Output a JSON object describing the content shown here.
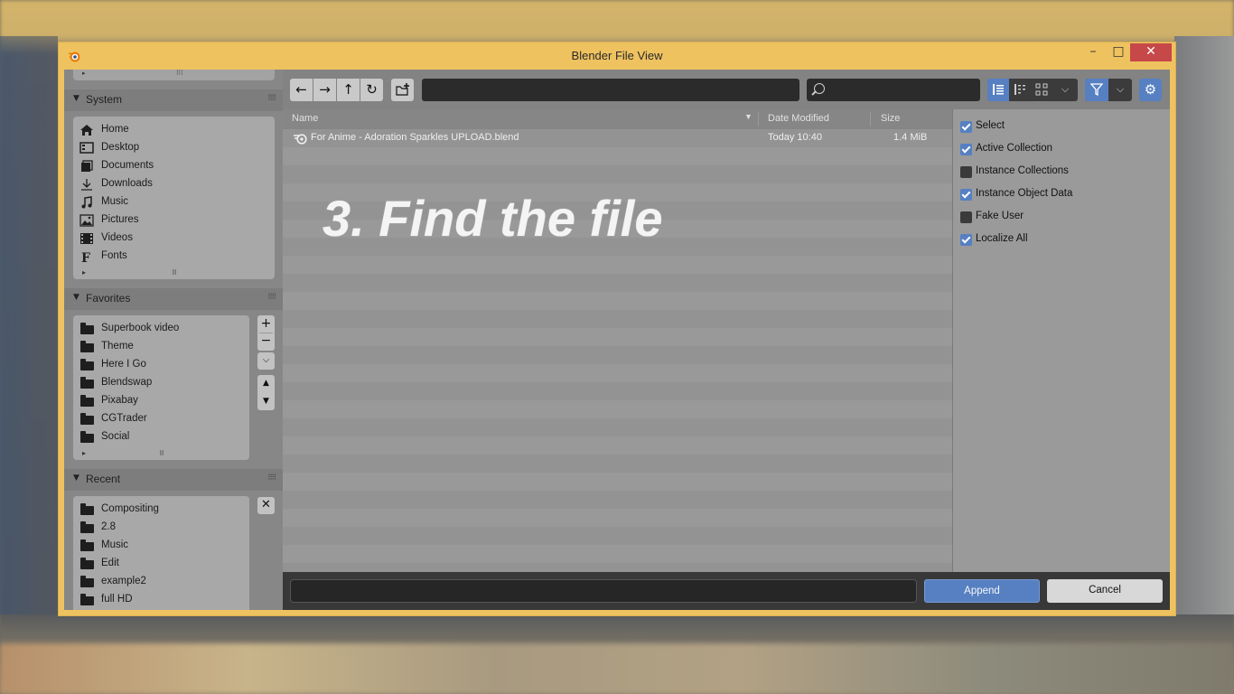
{
  "window": {
    "title": "Blender File View",
    "minimize_glyph": "–",
    "maximize_glyph": "□",
    "close_glyph": "✕"
  },
  "sidebar": {
    "system": {
      "title": "System",
      "items": [
        {
          "label": "Home",
          "icon": "home-icon"
        },
        {
          "label": "Desktop",
          "icon": "desktop-icon"
        },
        {
          "label": "Documents",
          "icon": "documents-icon"
        },
        {
          "label": "Downloads",
          "icon": "download-icon"
        },
        {
          "label": "Music",
          "icon": "music-icon"
        },
        {
          "label": "Pictures",
          "icon": "pictures-icon"
        },
        {
          "label": "Videos",
          "icon": "videos-icon"
        },
        {
          "label": "Fonts",
          "icon": "font-icon"
        }
      ]
    },
    "favorites": {
      "title": "Favorites",
      "items": [
        {
          "label": "Superbook video"
        },
        {
          "label": "Theme"
        },
        {
          "label": "Here I Go"
        },
        {
          "label": "Blendswap"
        },
        {
          "label": "Pixabay"
        },
        {
          "label": "CGTrader"
        },
        {
          "label": "Social"
        }
      ]
    },
    "recent": {
      "title": "Recent",
      "items": [
        {
          "label": "Compositing"
        },
        {
          "label": "2.8"
        },
        {
          "label": "Music"
        },
        {
          "label": "Edit"
        },
        {
          "label": "example2"
        },
        {
          "label": "full HD"
        }
      ]
    }
  },
  "toolbar": {
    "path_value": "",
    "search_value": ""
  },
  "filelist": {
    "columns": {
      "name": "Name",
      "date": "Date Modified",
      "size": "Size"
    },
    "files": [
      {
        "name": "For Anime - Adoration Sparkles UPLOAD.blend",
        "date": "Today 10:40",
        "size": "1.4 MiB"
      }
    ]
  },
  "overlay_caption": "3. Find the file",
  "options": [
    {
      "label": "Select",
      "checked": true
    },
    {
      "label": "Active Collection",
      "checked": true
    },
    {
      "label": "Instance Collections",
      "checked": false
    },
    {
      "label": "Instance Object Data",
      "checked": true
    },
    {
      "label": "Fake User",
      "checked": false
    },
    {
      "label": "Localize All",
      "checked": true
    }
  ],
  "bottom": {
    "filename_value": "",
    "append_label": "Append",
    "cancel_label": "Cancel"
  },
  "colors": {
    "accent": "#5680c2",
    "window_frame": "#efc260",
    "close": "#c74848"
  }
}
